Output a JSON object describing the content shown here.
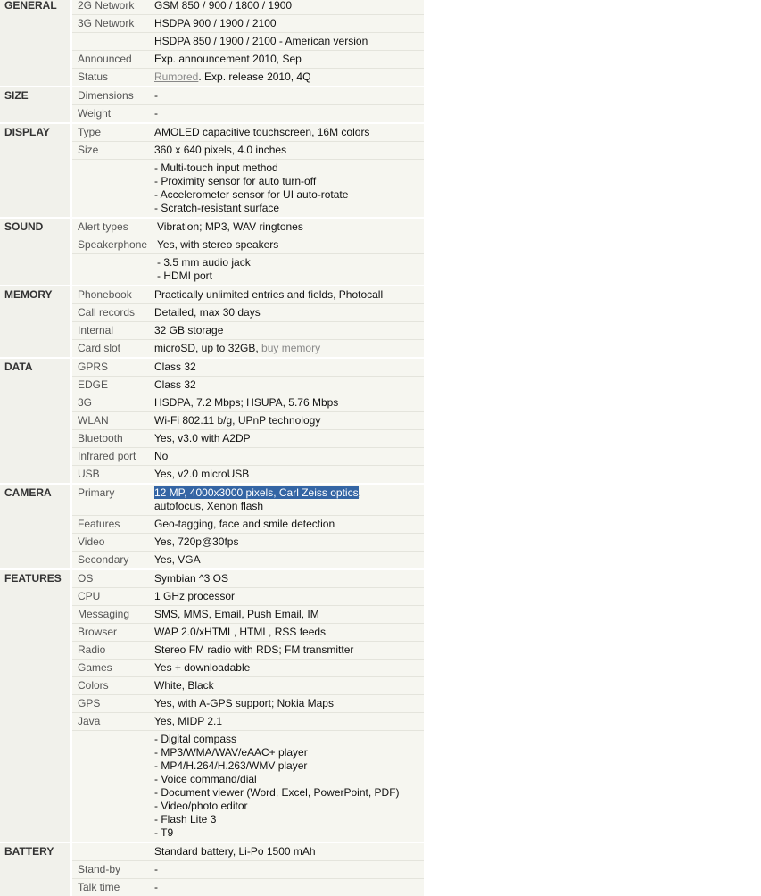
{
  "sections": [
    {
      "name": "GENERAL",
      "rows": [
        {
          "label": "2G Network",
          "lines": [
            "GSM 850 / 900 / 1800 / 1900"
          ]
        },
        {
          "label": "3G Network",
          "lines": [
            "HSDPA 900 / 1900 / 2100"
          ]
        },
        {
          "label": "",
          "lines": [
            "HSDPA 850 / 1900 / 2100 - American version"
          ]
        },
        {
          "label": "Announced",
          "lines": [
            "Exp. announcement 2010, Sep"
          ]
        },
        {
          "label": "Status",
          "link_text": "Rumored",
          "after_link": ". Exp. release 2010, 4Q"
        }
      ]
    },
    {
      "name": "SIZE",
      "rows": [
        {
          "label": "Dimensions",
          "lines": [
            "-"
          ]
        },
        {
          "label": "Weight",
          "lines": [
            "-"
          ]
        }
      ]
    },
    {
      "name": "DISPLAY",
      "rows": [
        {
          "label": "Type",
          "lines": [
            "AMOLED capacitive touchscreen, 16M colors"
          ]
        },
        {
          "label": "Size",
          "lines": [
            "360 x 640 pixels, 4.0 inches"
          ]
        },
        {
          "label": "",
          "lines": [
            "- Multi-touch input method",
            "- Proximity sensor for auto turn-off",
            "- Accelerometer sensor for UI auto-rotate",
            "- Scratch-resistant surface"
          ]
        }
      ]
    },
    {
      "name": "SOUND",
      "indent": true,
      "rows": [
        {
          "label": "Alert types",
          "lines": [
            "Vibration; MP3, WAV ringtones"
          ]
        },
        {
          "label": "Speakerphone",
          "lines": [
            "Yes, with stereo speakers"
          ]
        },
        {
          "label": "",
          "lines": [
            "- 3.5 mm audio jack",
            "- HDMI port"
          ]
        }
      ]
    },
    {
      "name": "MEMORY",
      "rows": [
        {
          "label": "Phonebook",
          "lines": [
            "Practically unlimited entries and fields, Photocall"
          ]
        },
        {
          "label": "Call records",
          "lines": [
            "Detailed, max 30 days"
          ]
        },
        {
          "label": "Internal",
          "lines": [
            "32 GB storage"
          ]
        },
        {
          "label": "Card slot",
          "before_link": "microSD, up to 32GB, ",
          "link_text": "buy memory"
        }
      ]
    },
    {
      "name": "DATA",
      "rows": [
        {
          "label": "GPRS",
          "lines": [
            "Class 32"
          ]
        },
        {
          "label": "EDGE",
          "lines": [
            "Class 32"
          ]
        },
        {
          "label": "3G",
          "lines": [
            "HSDPA, 7.2 Mbps; HSUPA, 5.76 Mbps"
          ]
        },
        {
          "label": "WLAN",
          "lines": [
            "Wi-Fi 802.11 b/g, UPnP technology"
          ]
        },
        {
          "label": "Bluetooth",
          "lines": [
            "Yes, v3.0 with A2DP"
          ]
        },
        {
          "label": "Infrared port",
          "lines": [
            "No"
          ]
        },
        {
          "label": "USB",
          "lines": [
            "Yes, v2.0 microUSB"
          ]
        }
      ]
    },
    {
      "name": "CAMERA",
      "rows": [
        {
          "label": "Primary",
          "highlight": "12 MP, 4000x3000 pixels, Carl Zeiss optics",
          "after_highlight": ",",
          "lines": [
            "autofocus, Xenon flash"
          ]
        },
        {
          "label": "Features",
          "lines": [
            "Geo-tagging, face and smile detection"
          ]
        },
        {
          "label": "Video",
          "lines": [
            "Yes, 720p@30fps"
          ]
        },
        {
          "label": "Secondary",
          "lines": [
            "Yes, VGA"
          ]
        }
      ]
    },
    {
      "name": "FEATURES",
      "rows": [
        {
          "label": "OS",
          "lines": [
            "Symbian ^3 OS"
          ]
        },
        {
          "label": "CPU",
          "lines": [
            "1 GHz processor"
          ]
        },
        {
          "label": "Messaging",
          "lines": [
            "SMS, MMS, Email, Push Email, IM"
          ]
        },
        {
          "label": "Browser",
          "lines": [
            "WAP 2.0/xHTML, HTML, RSS feeds"
          ]
        },
        {
          "label": "Radio",
          "lines": [
            "Stereo FM radio with RDS; FM transmitter"
          ]
        },
        {
          "label": "Games",
          "lines": [
            "Yes + downloadable"
          ]
        },
        {
          "label": "Colors",
          "lines": [
            "White, Black"
          ]
        },
        {
          "label": "GPS",
          "lines": [
            "Yes, with A-GPS support; Nokia Maps"
          ]
        },
        {
          "label": "Java",
          "lines": [
            "Yes, MIDP 2.1"
          ]
        },
        {
          "label": "",
          "lines": [
            "- Digital compass",
            "- MP3/WMA/WAV/eAAC+ player",
            "- MP4/H.264/H.263/WMV player",
            "- Voice command/dial",
            "- Document viewer (Word, Excel, PowerPoint, PDF)",
            "- Video/photo editor",
            "- Flash Lite 3",
            "- T9"
          ]
        }
      ]
    },
    {
      "name": "BATTERY",
      "rows": [
        {
          "label": "",
          "lines": [
            "Standard battery, Li-Po 1500 mAh"
          ]
        },
        {
          "label": "Stand-by",
          "lines": [
            "-"
          ]
        },
        {
          "label": "Talk time",
          "lines": [
            "-"
          ]
        }
      ]
    }
  ]
}
